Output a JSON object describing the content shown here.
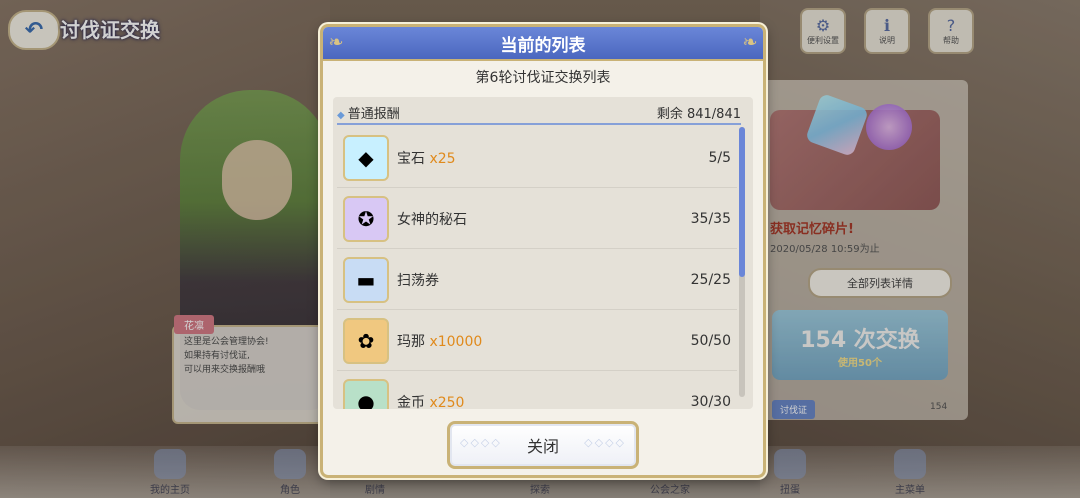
{
  "screen": {
    "title": "讨伐证交换",
    "back_icon": "back-arrow-icon"
  },
  "top_icons": [
    {
      "name": "gear-icon",
      "label": "便利设置"
    },
    {
      "name": "info-icon",
      "label": "说明"
    },
    {
      "name": "help-icon",
      "label": "帮助"
    }
  ],
  "speech": {
    "speaker": "花凛",
    "lines": [
      "这里是公会管理协会!",
      "如果持有讨伐证,",
      "可以用来交换报酬哦"
    ]
  },
  "right_panel": {
    "promo_text": "获取记忆碎片!",
    "deadline": "2020/05/28 10:59为止",
    "detail_button": "全部列表详情",
    "exchange_count": "154 次交换",
    "exchange_sub": "使用50个",
    "tag": "讨伐证",
    "owned": "154"
  },
  "bottom_nav": [
    "我的主页",
    "角色",
    "剧情",
    "探索",
    "公会之家",
    "扭蛋",
    "主菜单"
  ],
  "modal": {
    "title": "当前的列表",
    "subtitle": "第6轮讨伐证交换列表",
    "section": {
      "label": "普通报酬",
      "remaining": "剩余 841/841"
    },
    "items": [
      {
        "name": "宝石",
        "qty": "x25",
        "count": "5/5",
        "icon": "gem-icon",
        "color": "#c8f0ff"
      },
      {
        "name": "女神的秘石",
        "qty": "",
        "count": "35/35",
        "icon": "goddess-stone-icon",
        "color": "#d8c8f4"
      },
      {
        "name": "扫荡券",
        "qty": "",
        "count": "25/25",
        "icon": "sweep-ticket-icon",
        "color": "#c8dcf4"
      },
      {
        "name": "玛那",
        "qty": "x10000",
        "count": "50/50",
        "icon": "mana-icon",
        "color": "#f0c880"
      },
      {
        "name": "金币",
        "qty": "x250",
        "count": "30/30",
        "icon": "coin-icon",
        "color": "#b8e0c8"
      }
    ],
    "close_label": "关闭"
  },
  "colors": {
    "header_blue": "#4b67bf",
    "gold_border": "#c9b276",
    "qty_orange": "#e08a1c"
  }
}
